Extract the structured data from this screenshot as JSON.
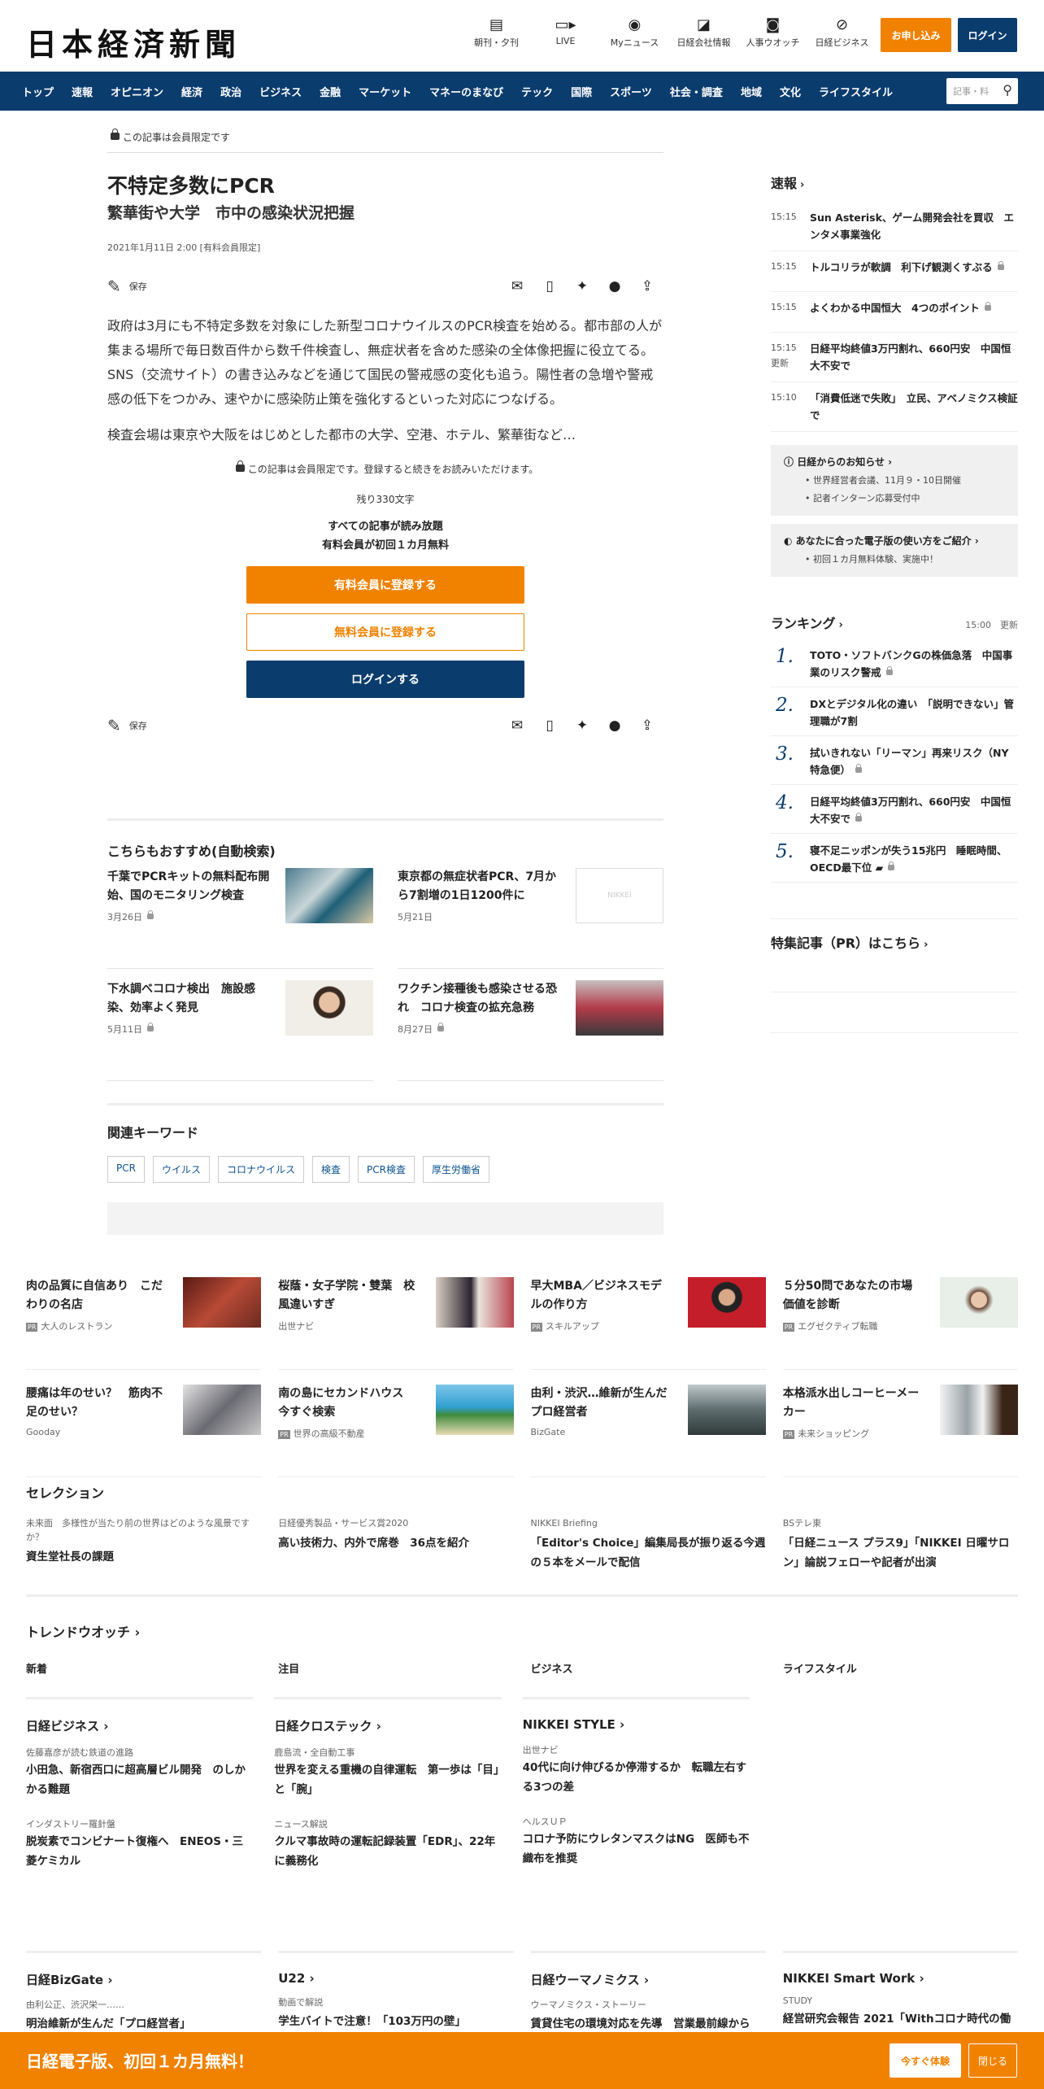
{
  "header": {
    "logo": "日本経済新聞",
    "icons": [
      {
        "label": "朝刊・夕刊",
        "icon": "newspaper-icon"
      },
      {
        "label": "LIVE",
        "icon": "video-icon"
      },
      {
        "label": "Myニュース",
        "icon": "person-icon"
      },
      {
        "label": "日経会社情報",
        "icon": "chart-icon"
      },
      {
        "label": "人事ウオッチ",
        "icon": "search-person-icon"
      },
      {
        "label": "日経ビジネス",
        "icon": "compass-icon"
      }
    ],
    "subscribe": "お申し込み",
    "login": "ログイン"
  },
  "nav": {
    "items": [
      "トップ",
      "速報",
      "オピニオン",
      "経済",
      "政治",
      "ビジネス",
      "金融",
      "マーケット",
      "マネーのまなび",
      "テック",
      "国際",
      "スポーツ",
      "社会・調査",
      "地域",
      "文化",
      "ライフスタイル"
    ],
    "search_placeholder": "記事・料"
  },
  "article": {
    "lock": "この記事は会員限定です",
    "title": "不特定多数にPCR",
    "subtitle": "繁華街や大学　市中の感染状況把握",
    "date": "2021年1月11日 2:00 [有料会員限定]",
    "save": "保存",
    "p1": "政府は3月にも不特定多数を対象にした新型コロナウイルスのPCR検査を始める。都市部の人が集まる場所で毎日数百件から数千件検査し、無症状者を含めた感染の全体像把握に役立てる。SNS（交流サイト）の書き込みなどを通じて国民の警戒感の変化も追う。陽性者の急増や警戒感の低下をつかみ、速やかに感染防止策を強化するといった対応につなげる。",
    "p2": "検査会場は東京や大阪をはじめとした都市の大学、空港、ホテル、繁華街など…",
    "notice": "この記事は会員限定です。登録すると続きをお読みいただけます。",
    "remain": "残り330文字",
    "perk1": "すべての記事が読み放題",
    "perk2": "有料会員が初回１カ月無料",
    "btn_paid": "有料会員に登録する",
    "btn_free": "無料会員に登録する",
    "btn_login": "ログインする"
  },
  "recommend": {
    "heading": "こちらもおすすめ(自動検索)",
    "items": [
      {
        "title": "千葉でPCRキットの無料配布開始、国のモニタリング検査",
        "date": "3月26日"
      },
      {
        "title": "東京都の無症状者PCR、7月から7割増の1日1200件に",
        "date": "5月21日"
      },
      {
        "title": "下水調べコロナ検出　施設感染、効率よく発見",
        "date": "5月11日"
      },
      {
        "title": "ワクチン接種後も感染させる恐れ　コロナ検査の拡充急務",
        "date": "8月27日"
      }
    ],
    "nikkei_placeholder": "NIKKEI"
  },
  "keywords": {
    "heading": "関連キーワード",
    "items": [
      "PCR",
      "ウイルス",
      "コロナウイルス",
      "検査",
      "PCR検査",
      "厚生労働省"
    ]
  },
  "sidebar": {
    "flash_heading": "速報",
    "flash": [
      {
        "time": "15:15",
        "text": "Sun Asterisk、ゲーム開発会社を買収　エンタメ事業強化"
      },
      {
        "time": "15:15",
        "text": "トルコリラが軟調　利下げ観測くすぶる"
      },
      {
        "time": "15:15",
        "text": "よくわかる中国恒大　4つのポイント"
      },
      {
        "time": "15:15",
        "update": "更新",
        "text": "日経平均終値3万円割れ、660円安　中国恒大不安で"
      },
      {
        "time": "15:10",
        "text": "「消費低迷で失敗」　立民、アベノミクス検証で"
      }
    ],
    "info1_heading": "日経からのお知らせ",
    "info1_items": [
      "世界経営者会議、11月９・10日開催",
      "記者インターン応募受付中"
    ],
    "info2_heading": "あなたに合った電子版の使い方をご紹介",
    "info2_items": [
      "初回１カ月無料体験、実施中！"
    ],
    "ranking_heading": "ランキング",
    "ranking_time": "15:00",
    "ranking_update": "更新",
    "ranking": [
      {
        "n": "1.",
        "text": "TOTO・ソフトバンクGの株価急落　中国事業のリスク警戒"
      },
      {
        "n": "2.",
        "text": "DXとデジタル化の違い　「説明できない」管理職が7割"
      },
      {
        "n": "3.",
        "text": "拭いきれない「リーマン」再来リスク（NY特急便）"
      },
      {
        "n": "4.",
        "text": "日経平均終値3万円割れ、660円安　中国恒大不安で"
      },
      {
        "n": "5.",
        "text": "寝不足ニッポンが失う15兆円　睡眠時間、OECD最下位"
      }
    ],
    "pr_heading": "特集記事（PR）はこちら"
  },
  "ads": [
    {
      "title": "肉の品質に自信あり　こだわりの名店",
      "pr": "PR",
      "source": "大人のレストラン"
    },
    {
      "title": "桜蔭・女子学院・雙葉　校風違いすぎ",
      "pr": "",
      "source": "出世ナビ"
    },
    {
      "title": "早大MBA／ビジネスモデルの作り方",
      "pr": "PR",
      "source": "スキルアップ"
    },
    {
      "title": "５分50問であなたの市場価値を診断",
      "pr": "PR",
      "source": "エグゼクティブ転職"
    },
    {
      "title": "腰痛は年のせい？　筋肉不足のせい？",
      "pr": "",
      "source": "Gooday"
    },
    {
      "title": "南の島にセカンドハウス　今すぐ検索",
      "pr": "PR",
      "source": "世界の高級不動産"
    },
    {
      "title": "由利・渋沢…維新が生んだプロ経営者",
      "pr": "",
      "source": "BizGate"
    },
    {
      "title": "本格派水出しコーヒーメーカー",
      "pr": "PR",
      "source": "未来ショッピング"
    }
  ],
  "selection": {
    "heading": "セレクション",
    "items": [
      {
        "label": "未来面　多様性が当たり前の世界はどのような風景ですか？",
        "title": "資生堂社長の課題"
      },
      {
        "label": "日経優秀製品・サービス賞2020",
        "title": "高い技術力、内外で席巻　36点を紹介"
      },
      {
        "label": "NIKKEI Briefing",
        "title": "「Editor's Choice」編集局長が振り返る今週の５本をメールで配信"
      },
      {
        "label": "BSテレ東",
        "title": "「日経ニュース プラス9」「NIKKEI 日曜サロン」論説フェローや記者が出演"
      }
    ]
  },
  "trend": {
    "heading": "トレンドウオッチ",
    "cols": [
      "新着",
      "注目",
      "ビジネス",
      "ライフスタイル"
    ]
  },
  "media": [
    {
      "heading": "日経ビジネス",
      "items": [
        {
          "label": "佐藤嘉彦が読む鉄道の進路",
          "title": "小田急、新宿西口に超高層ビル開発　のしかかる難題"
        },
        {
          "label": "インダストリー羅針盤",
          "title": "脱炭素でコンビナート復権へ　ENEOS・三菱ケミカル"
        }
      ]
    },
    {
      "heading": "日経クロステック",
      "items": [
        {
          "label": "鹿島流・全自動工事",
          "title": "世界を変える重機の自律運転　第一歩は「目」と「腕」"
        },
        {
          "label": "ニュース解説",
          "title": "クルマ事故時の運転記録装置「EDR」、22年に義務化"
        }
      ]
    },
    {
      "heading": "NIKKEI STYLE",
      "items": [
        {
          "label": "出世ナビ",
          "title": "40代に向け伸びるか停滞するか　転職左右する3つの差"
        },
        {
          "label": "ヘルスＵＰ",
          "title": "コロナ予防にウレタンマスクはNG　医師も不織布を推奨"
        }
      ]
    }
  ],
  "media2": [
    {
      "heading": "日経BizGate",
      "label": "由利公正、渋沢栄一……",
      "title": "明治維新が生んだ「プロ経営者」"
    },
    {
      "heading": "U22",
      "label": "動画で解説",
      "title": "学生バイトで注意！「103万円の壁」"
    },
    {
      "heading": "日経ウーマノミクス",
      "label": "ウーマノミクス・ストーリー",
      "title": "賃貸住宅の環境対応を先導　営業最前線から"
    },
    {
      "heading": "NIKKEI Smart Work",
      "label": "STUDY",
      "title": "経営研究会報告 2021「Withコロナ時代の働"
    }
  ],
  "banner": {
    "text": "日経電子版、初回１カ月無料！",
    "try": "今すぐ体験",
    "close": "閉じる"
  }
}
